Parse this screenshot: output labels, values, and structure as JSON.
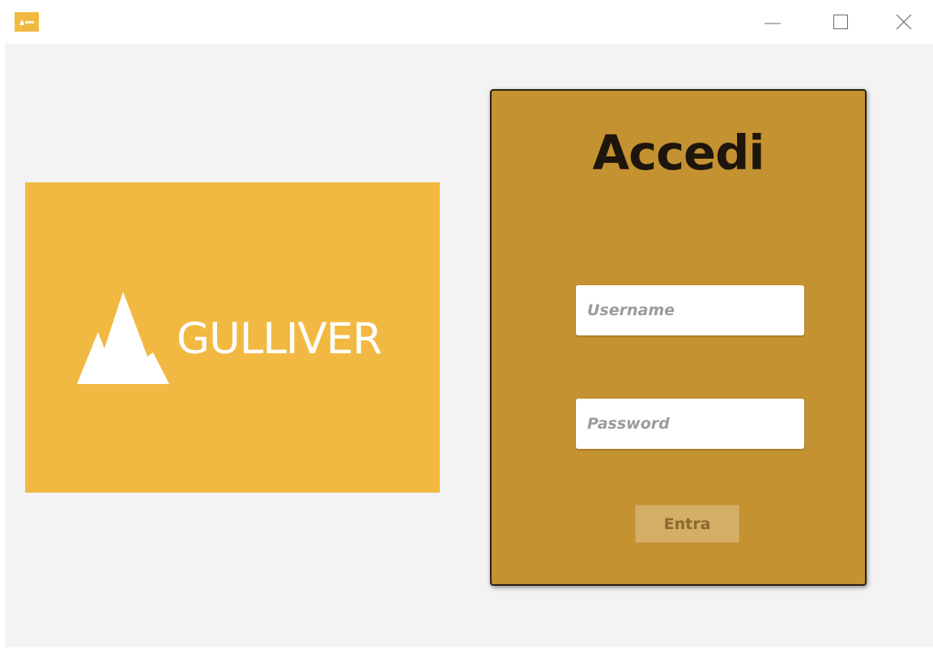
{
  "window": {
    "app_icon": "gulliver-app-icon",
    "controls": {
      "minimize": "minimize-icon",
      "maximize": "maximize-icon",
      "close": "close-icon"
    }
  },
  "brand": {
    "name": "GULLIVER",
    "logo_icon": "mountain-icon",
    "background_color": "#f2b942"
  },
  "login": {
    "title": "Accedi",
    "username_placeholder": "Username",
    "password_placeholder": "Password",
    "submit_label": "Entra",
    "card_color": "#c49230"
  }
}
